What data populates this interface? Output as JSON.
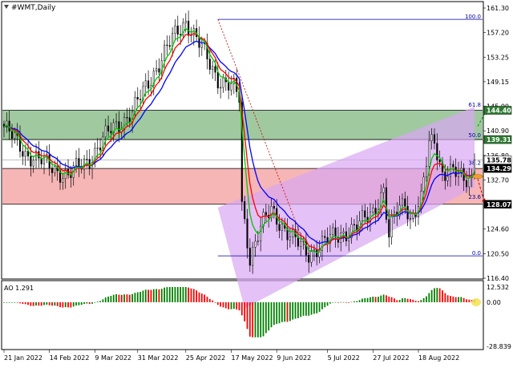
{
  "main_chart": {
    "title": "#WMT,Daily",
    "price_axis": [
      "161.30",
      "157.20",
      "153.25",
      "149.15",
      "145.00",
      "140.90",
      "136.80",
      "132.70",
      "128.60",
      "124.60",
      "120.50",
      "116.40"
    ],
    "price_tags": [
      {
        "label": "144.40",
        "value": 144.4,
        "bg": "#2e7d32",
        "fg": "#ffffff"
      },
      {
        "label": "139.31",
        "value": 139.31,
        "bg": "#2e7d32",
        "fg": "#ffffff"
      },
      {
        "label": "135.78",
        "value": 135.78,
        "bg": "#ffffff",
        "fg": "#000000"
      },
      {
        "label": "134.29",
        "value": 134.29,
        "bg": "#000000",
        "fg": "#ffffff"
      },
      {
        "label": "128.07",
        "value": 128.07,
        "bg": "#000000",
        "fg": "#ffffff"
      }
    ],
    "fib_labels": [
      {
        "label": "100.0",
        "value": 160.2
      },
      {
        "label": "61.8",
        "value": 144.9
      },
      {
        "label": "50.0",
        "value": 139.6
      },
      {
        "label": "38.2",
        "value": 134.8
      },
      {
        "label": "23.6",
        "value": 128.9
      },
      {
        "label": "0.0",
        "value": 119.1
      }
    ]
  },
  "indicator": {
    "label": "AO 1.291",
    "axis": [
      "12.532",
      "0.00",
      "-28.839"
    ]
  },
  "time_axis": [
    "21 Jan 2022",
    "14 Feb 2022",
    "9 Mar 2022",
    "31 Mar 2022",
    "25 Apr 2022",
    "17 May 2022",
    "9 Jun 2022",
    "5 Jul 2022",
    "27 Jul 2022",
    "18 Aug 2022"
  ],
  "colors": {
    "bull_zone": "#8fbf8f",
    "bear_zone": "#f4a9a9",
    "channel": "#d9a6f2",
    "ma_fast": "#00c800",
    "ma_mid": "#ff0000",
    "ma_slow": "#0000ff",
    "ao_up": "#008000",
    "ao_down": "#ff0000"
  },
  "chart_data": {
    "type": "candlestick",
    "title": "#WMT,Daily",
    "ylim": [
      115.5,
      163.0
    ],
    "dates": [
      "21 Jan 2022",
      "14 Feb 2022",
      "9 Mar 2022",
      "31 Mar 2022",
      "25 Apr 2022",
      "17 May 2022",
      "9 Jun 2022",
      "5 Jul 2022",
      "27 Jul 2022",
      "18 Aug 2022"
    ],
    "close_keypoints": [
      {
        "i": 0,
        "v": 141.5
      },
      {
        "i": 8,
        "v": 137.0
      },
      {
        "i": 16,
        "v": 135.0
      },
      {
        "i": 24,
        "v": 133.0
      },
      {
        "i": 32,
        "v": 136.0
      },
      {
        "i": 40,
        "v": 141.0
      },
      {
        "i": 48,
        "v": 144.0
      },
      {
        "i": 56,
        "v": 151.0
      },
      {
        "i": 64,
        "v": 157.5
      },
      {
        "i": 68,
        "v": 160.0
      },
      {
        "i": 74,
        "v": 155.0
      },
      {
        "i": 80,
        "v": 150.0
      },
      {
        "i": 86,
        "v": 148.0
      },
      {
        "i": 88,
        "v": 146.5
      },
      {
        "i": 89,
        "v": 128.0
      },
      {
        "i": 92,
        "v": 119.0
      },
      {
        "i": 96,
        "v": 124.0
      },
      {
        "i": 100,
        "v": 127.0
      },
      {
        "i": 108,
        "v": 122.0
      },
      {
        "i": 114,
        "v": 119.5
      },
      {
        "i": 120,
        "v": 121.5
      },
      {
        "i": 126,
        "v": 123.0
      },
      {
        "i": 132,
        "v": 124.0
      },
      {
        "i": 138,
        "v": 127.0
      },
      {
        "i": 142,
        "v": 130.5
      },
      {
        "i": 144,
        "v": 122.0
      },
      {
        "i": 146,
        "v": 126.0
      },
      {
        "i": 150,
        "v": 129.0
      },
      {
        "i": 152,
        "v": 125.5
      },
      {
        "i": 156,
        "v": 128.5
      },
      {
        "i": 159,
        "v": 138.5
      },
      {
        "i": 161,
        "v": 139.5
      },
      {
        "i": 164,
        "v": 133.5
      },
      {
        "i": 168,
        "v": 133.5
      },
      {
        "i": 172,
        "v": 132.5
      },
      {
        "i": 175,
        "v": 133.0
      },
      {
        "i": 176,
        "v": 135.8
      }
    ],
    "bar_count": 177,
    "last_close": 135.78
  }
}
